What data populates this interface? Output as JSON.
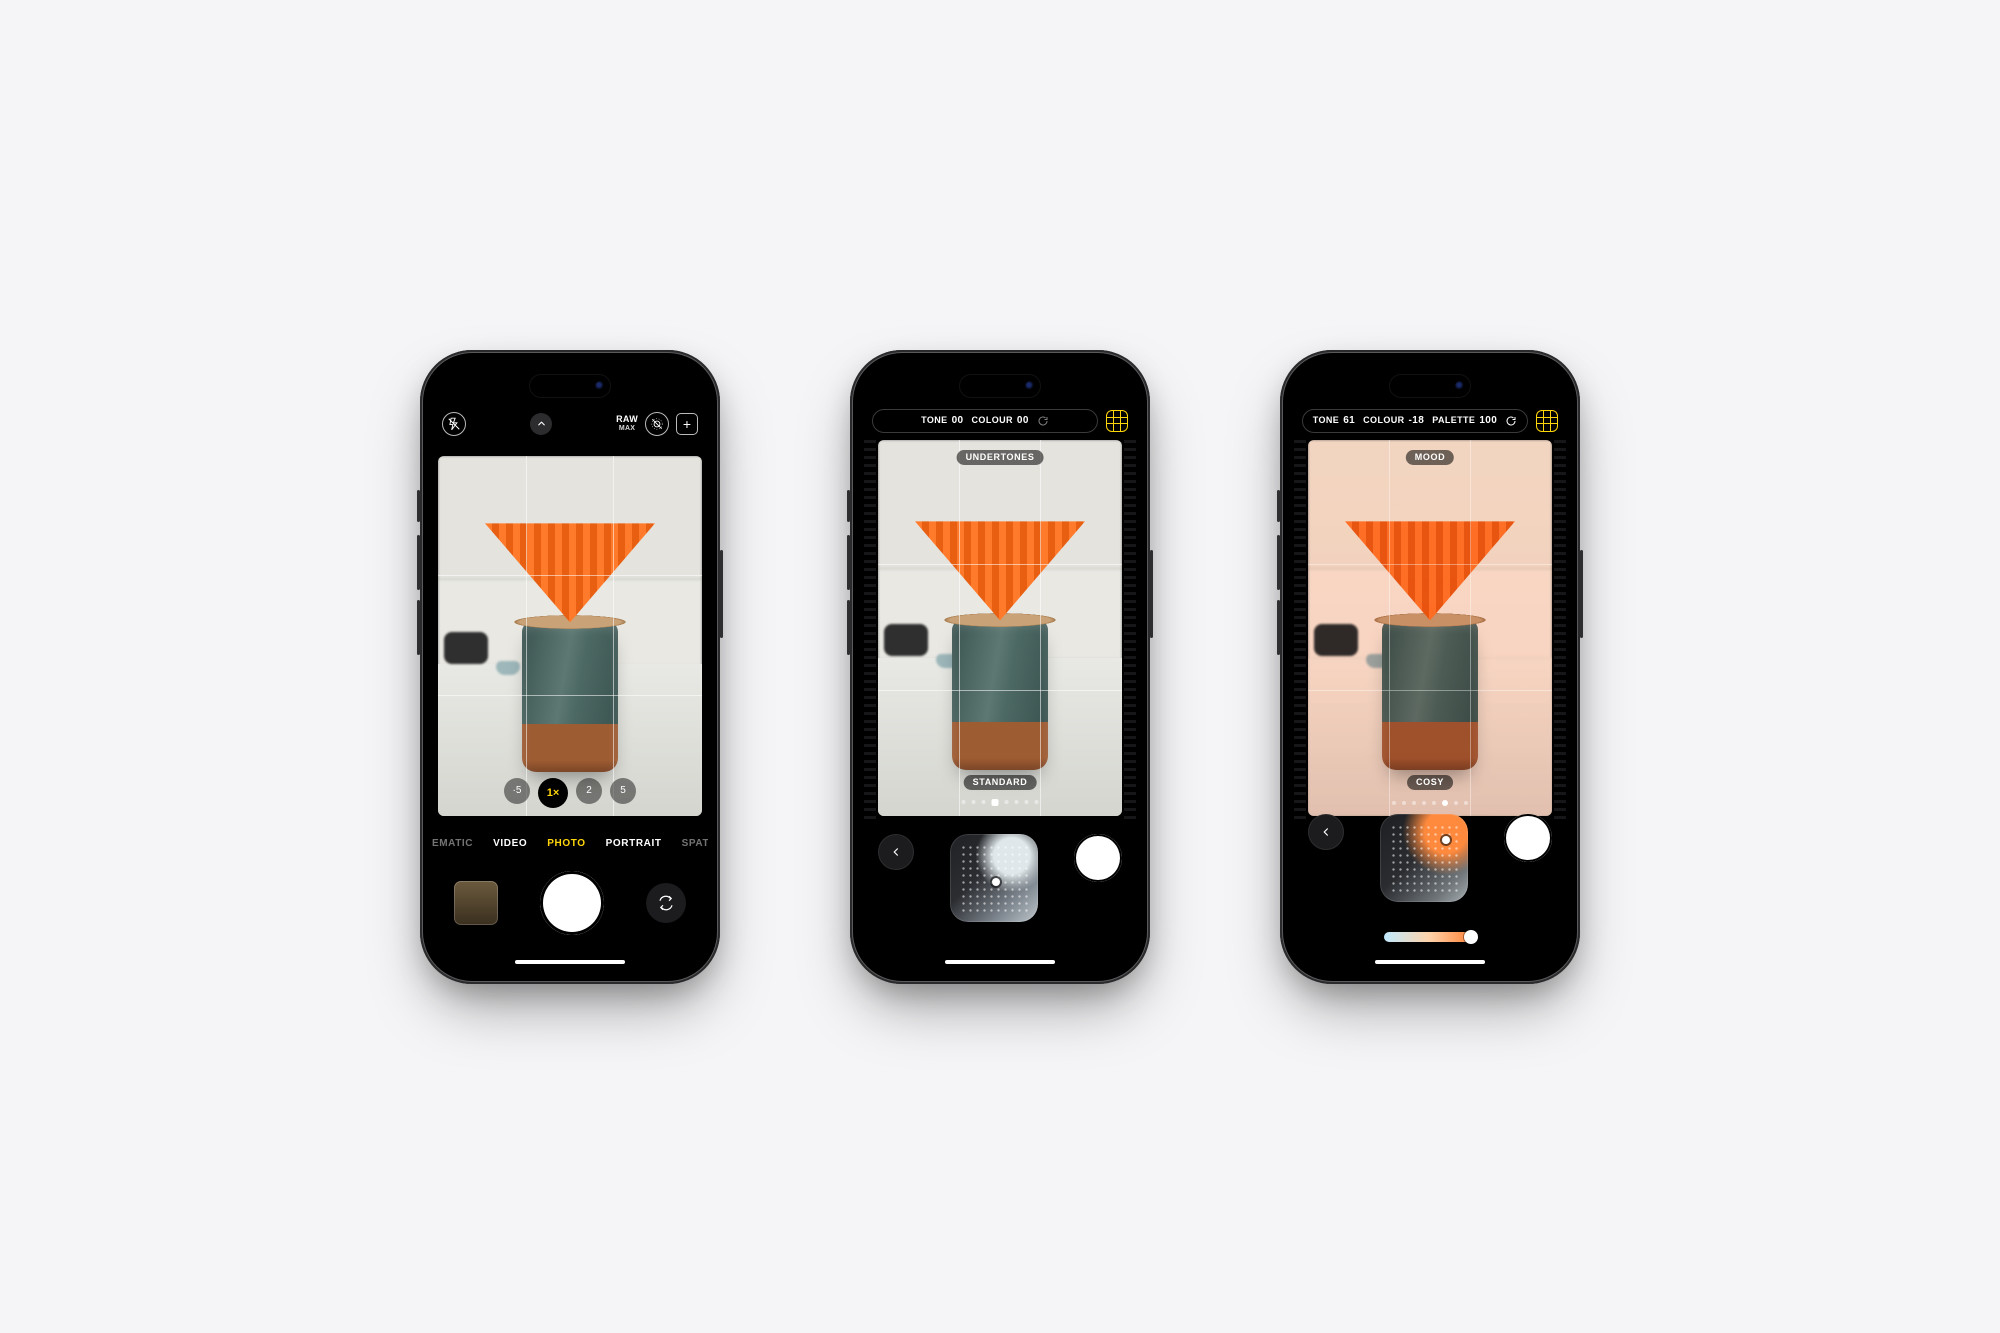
{
  "phone1": {
    "raw": {
      "top": "RAW",
      "bottom": "MAX"
    },
    "zoom": [
      "·5",
      "1×",
      "2",
      "5"
    ],
    "zoom_active_index": 1,
    "modes": [
      "CINEMATIC",
      "VIDEO",
      "PHOTO",
      "PORTRAIT",
      "SPATIAL"
    ],
    "mode_active_index": 2
  },
  "phone2": {
    "tone_label": "TONE",
    "tone_value": "00",
    "colour_label": "COLOUR",
    "colour_value": "00",
    "category_label": "UNDERTONES",
    "style_label": "STANDARD",
    "dots_selected_index": 3
  },
  "phone3": {
    "tone_label": "TONE",
    "tone_value": "61",
    "colour_label": "COLOUR",
    "colour_value": "-18",
    "palette_label": "PALETTE",
    "palette_value": "100",
    "category_label": "MOOD",
    "style_label": "COSY",
    "dots_selected_index": 5
  }
}
